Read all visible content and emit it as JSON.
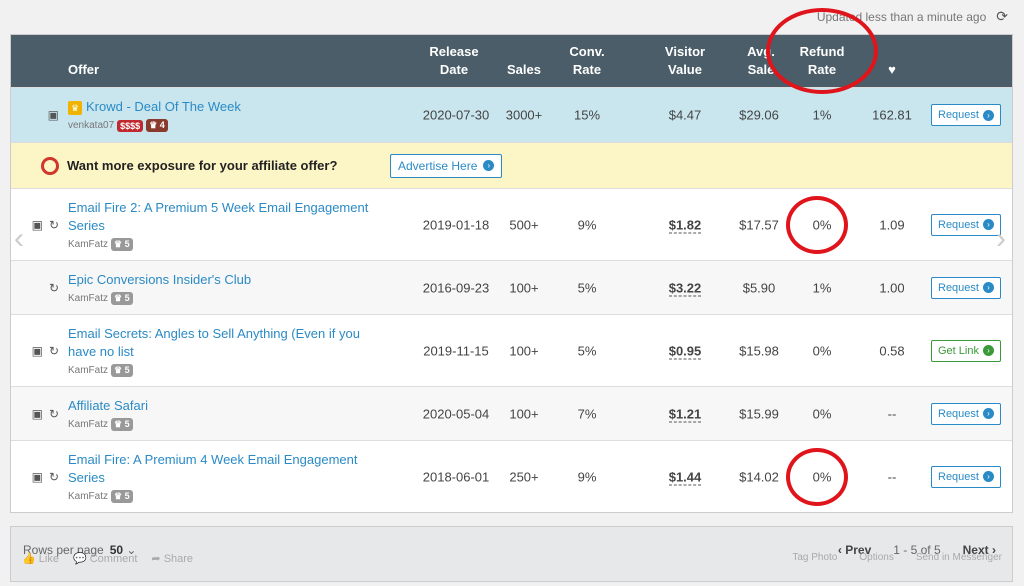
{
  "top": {
    "updated": "Updated less than a minute ago",
    "refresh_icon": "refresh-icon"
  },
  "header": {
    "offer": "Offer",
    "release_1": "Release",
    "release_2": "Date",
    "sales": "Sales",
    "conv_1": "Conv.",
    "conv_2": "Rate",
    "visitor_1": "Visitor",
    "visitor_2": "Value",
    "avg_1": "Avg.",
    "avg_2": "Sale",
    "refund_1": "Refund",
    "refund_2": "Rate",
    "heart": "♥"
  },
  "featured": {
    "title": "Krowd - Deal Of The Week",
    "vendor": "venkata07",
    "badge_money": "$$$$",
    "badge_trophy": "4",
    "date": "2020-07-30",
    "sales": "3000+",
    "conv": "15%",
    "visitor": "$4.47",
    "avg": "$29.06",
    "refund": "1%",
    "score": "162.81",
    "action": "Request"
  },
  "promo": {
    "text": "Want more exposure for your affiliate offer?",
    "button": "Advertise Here"
  },
  "rows": [
    {
      "title1": "Email Fire 2: A Premium 5 Week Email Engagement",
      "title2": "Series",
      "vendor": "KamFatz",
      "badge": "5",
      "date": "2019-01-18",
      "sales": "500+",
      "conv": "9%",
      "visitor": "$1.82",
      "avg": "$17.57",
      "refund": "0%",
      "score": "1.09",
      "action": "Request"
    },
    {
      "title1": "Epic Conversions Insider's Club",
      "title2": "",
      "vendor": "KamFatz",
      "badge": "5",
      "date": "2016-09-23",
      "sales": "100+",
      "conv": "5%",
      "visitor": "$3.22",
      "avg": "$5.90",
      "refund": "1%",
      "score": "1.00",
      "action": "Request"
    },
    {
      "title1": "Email Secrets: Angles to Sell Anything (Even if you",
      "title2": "have no list",
      "vendor": "KamFatz",
      "badge": "5",
      "date": "2019-11-15",
      "sales": "100+",
      "conv": "5%",
      "visitor": "$0.95",
      "avg": "$15.98",
      "refund": "0%",
      "score": "0.58",
      "action": "Get Link"
    },
    {
      "title1": "Affiliate Safari",
      "title2": "",
      "vendor": "KamFatz",
      "badge": "5",
      "date": "2020-05-04",
      "sales": "100+",
      "conv": "7%",
      "visitor": "$1.21",
      "avg": "$15.99",
      "refund": "0%",
      "score": "--",
      "action": "Request"
    },
    {
      "title1": "Email Fire: A Premium 4 Week Email Engagement",
      "title2": "Series",
      "vendor": "KamFatz",
      "badge": "5",
      "date": "2018-06-01",
      "sales": "250+",
      "conv": "9%",
      "visitor": "$1.44",
      "avg": "$14.02",
      "refund": "0%",
      "score": "--",
      "action": "Request"
    }
  ],
  "footer": {
    "rows_label": "Rows per page",
    "rows_value": "50",
    "prev": "Prev",
    "range": "1 - 5 of 5",
    "next": "Next"
  },
  "fb": {
    "like": "Like",
    "comment": "Comment",
    "share": "Share",
    "tag": "Tag Photo",
    "options": "Options",
    "messenger": "Send in Messenger"
  }
}
